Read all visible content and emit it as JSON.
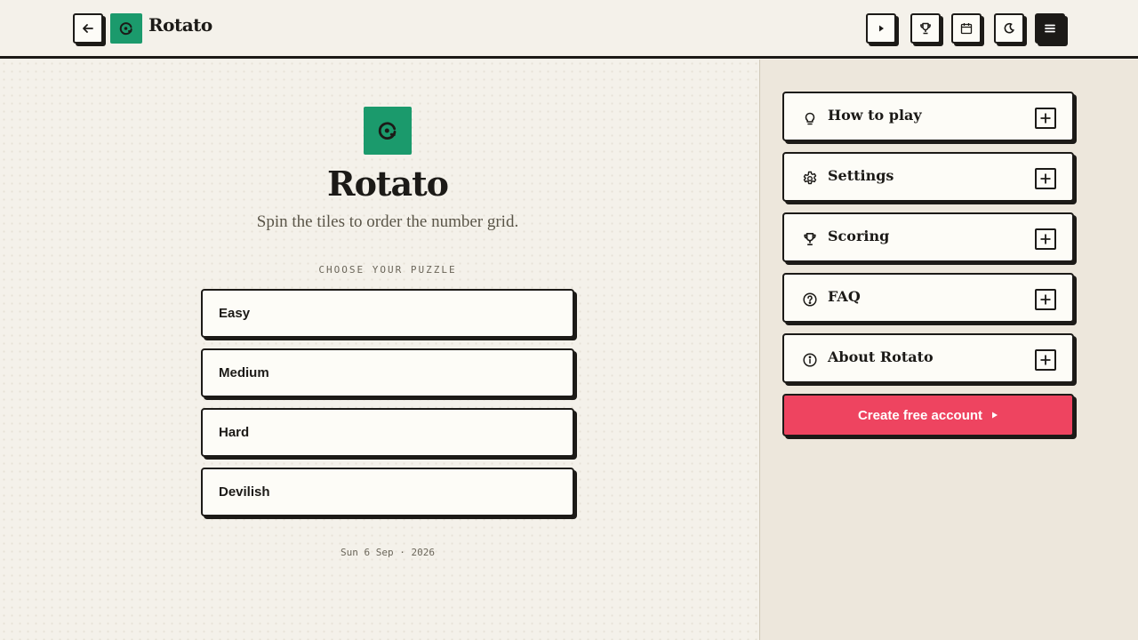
{
  "header": {
    "brand": "Rotato",
    "icons": [
      "back-arrow-icon",
      "rotato-logo-icon",
      "play-icon",
      "trophy-icon",
      "calendar-icon",
      "moon-icon",
      "menu-icon"
    ]
  },
  "main": {
    "title": "Rotato",
    "subtitle": "Spin the tiles to order the number grid.",
    "choose_label": "CHOOSE YOUR PUZZLE",
    "puzzles": [
      {
        "label": "Easy"
      },
      {
        "label": "Medium"
      },
      {
        "label": "Hard"
      },
      {
        "label": "Devilish"
      }
    ],
    "date": "Sun 6 Sep · 2026"
  },
  "sidebar": {
    "sections": [
      {
        "label": "How to play",
        "icon": "lightbulb-icon"
      },
      {
        "label": "Settings",
        "icon": "gear-icon"
      },
      {
        "label": "Scoring",
        "icon": "trophy-icon"
      },
      {
        "label": "FAQ",
        "icon": "question-icon"
      },
      {
        "label": "About Rotato",
        "icon": "info-icon"
      }
    ],
    "cta_label": "Create free account"
  },
  "colors": {
    "accent_green": "#1b9a6c",
    "cta_red": "#ee4460",
    "ink": "#1c1a17",
    "background": "#f4f1ea",
    "sidebar_background": "#ede7dc"
  }
}
